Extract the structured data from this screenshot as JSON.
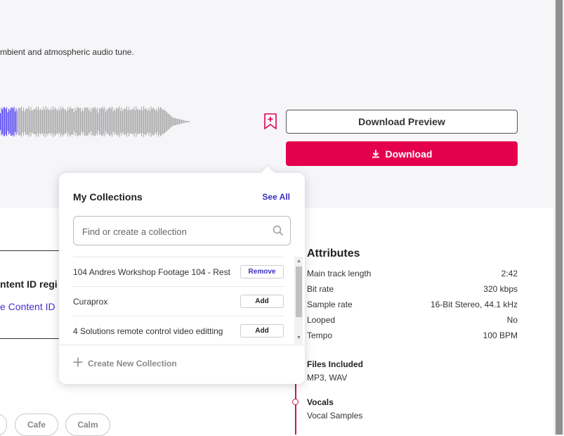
{
  "track": {
    "description": "mbient and atmospheric audio tune."
  },
  "actions": {
    "download_preview_label": "Download Preview",
    "download_label": "Download"
  },
  "content_id": {
    "heading": "ntent ID regi",
    "link": "e Content ID"
  },
  "tags": [
    "Cafe",
    "Calm"
  ],
  "collections_popup": {
    "title": "My Collections",
    "see_all": "See All",
    "search_placeholder": "Find or create a collection",
    "items": [
      {
        "name": "104 Andres Workshop Footage 104 - Rest",
        "action": "Remove"
      },
      {
        "name": "Curaprox",
        "action": "Add"
      },
      {
        "name": "4 Solutions remote control video editting",
        "action": "Add"
      }
    ],
    "create_new": "Create New Collection"
  },
  "attributes": {
    "title": "Attributes",
    "rows": [
      {
        "label": "Main track length",
        "value": "2:42"
      },
      {
        "label": "Bit rate",
        "value": "320 kbps"
      },
      {
        "label": "Sample rate",
        "value": "16-Bit Stereo, 44.1 kHz"
      },
      {
        "label": "Looped",
        "value": "No"
      },
      {
        "label": "Tempo",
        "value": "100 BPM"
      }
    ],
    "files_title": "Files Included",
    "files_value": "MP3, WAV",
    "vocals_title": "Vocals",
    "vocals_value": "Vocal Samples"
  },
  "colors": {
    "accent": "#e4004d",
    "link": "#3b2fc0",
    "waveform_played": "#5b4cf0",
    "waveform_unplayed": "#aaaaaa"
  }
}
